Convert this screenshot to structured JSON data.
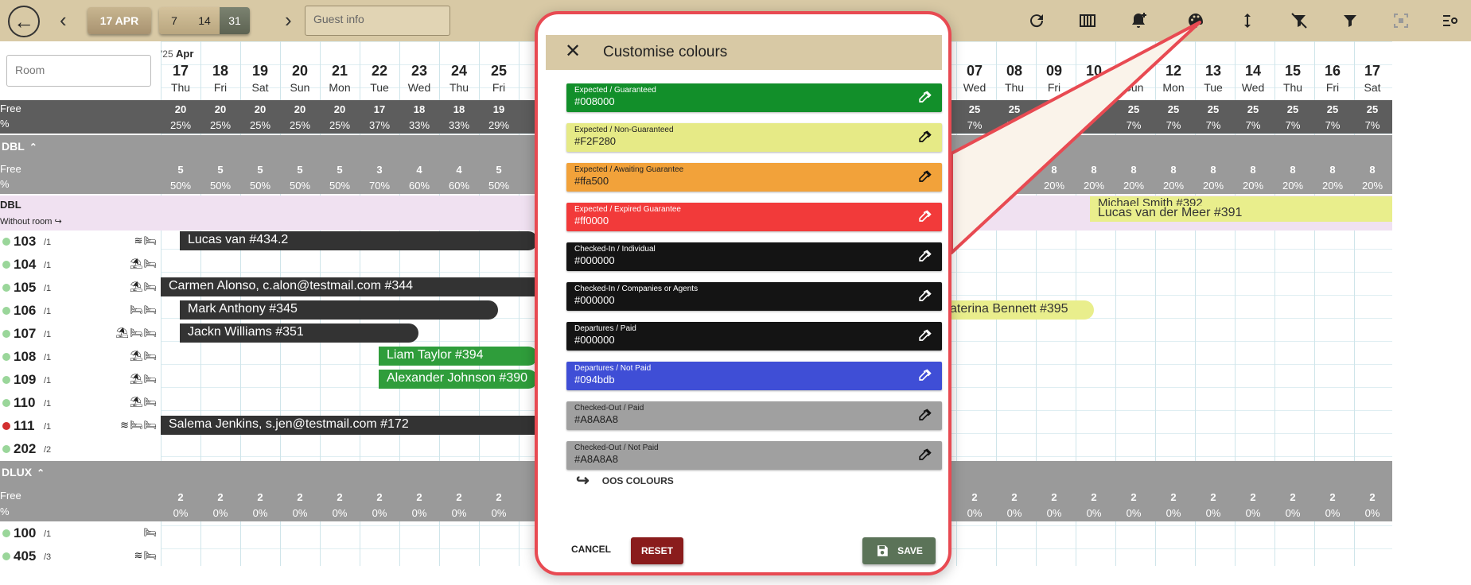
{
  "toolbar": {
    "back_icon": "arrow-left-icon",
    "prev_icon": "chevron-left-icon",
    "date_label": "17 APR",
    "ranges": [
      "7",
      "14",
      "31"
    ],
    "range_selected": "31",
    "next_icon": "chevron-right-icon",
    "guest_placeholder": "Guest info",
    "icons": [
      "refresh-icon",
      "columns-icon",
      "bell-plus-icon",
      "palette-icon",
      "vertical-resize-icon",
      "filter-off-icon",
      "filter-icon",
      "scan-icon",
      "list-settings-icon"
    ]
  },
  "grid": {
    "room_placeholder": "Room",
    "year_prefix": "'25",
    "month": "Apr",
    "dates_left": [
      {
        "d": "17",
        "w": "Thu"
      },
      {
        "d": "18",
        "w": "Fri"
      },
      {
        "d": "19",
        "w": "Sat"
      },
      {
        "d": "20",
        "w": "Sun"
      },
      {
        "d": "21",
        "w": "Mon"
      },
      {
        "d": "22",
        "w": "Tue"
      },
      {
        "d": "23",
        "w": "Wed"
      },
      {
        "d": "24",
        "w": "Thu"
      },
      {
        "d": "25",
        "w": "Fri"
      }
    ],
    "dates_right": [
      {
        "d": "07",
        "w": "Wed"
      },
      {
        "d": "08",
        "w": "Thu"
      },
      {
        "d": "09",
        "w": "Fri"
      },
      {
        "d": "10",
        "w": ""
      },
      {
        "d": "11",
        "w": "Sun"
      },
      {
        "d": "12",
        "w": "Mon"
      },
      {
        "d": "13",
        "w": "Tue"
      },
      {
        "d": "14",
        "w": "Wed"
      },
      {
        "d": "15",
        "w": "Thu"
      },
      {
        "d": "16",
        "w": "Fri"
      },
      {
        "d": "17",
        "w": "Sat"
      }
    ],
    "free_label": "Free",
    "pct_label": "%",
    "total_left": {
      "free": [
        "20",
        "20",
        "20",
        "20",
        "20",
        "17",
        "18",
        "18",
        "19"
      ],
      "pct": [
        "25%",
        "25%",
        "25%",
        "25%",
        "25%",
        "37%",
        "33%",
        "33%",
        "29%"
      ]
    },
    "total_right": {
      "free": [
        "25",
        "25",
        "",
        "",
        "25",
        "25",
        "25",
        "25",
        "25",
        "25",
        "25"
      ],
      "pct": [
        "7%",
        "7%",
        "7%",
        "",
        "7%",
        "7%",
        "7%",
        "7%",
        "7%",
        "7%",
        "7%"
      ]
    },
    "dbl_group": "DBL",
    "dbl_left": {
      "free": [
        "5",
        "5",
        "5",
        "5",
        "5",
        "3",
        "4",
        "4",
        "5"
      ],
      "pct": [
        "50%",
        "50%",
        "50%",
        "50%",
        "50%",
        "70%",
        "60%",
        "60%",
        "50%"
      ]
    },
    "dbl_right": {
      "free": [
        "",
        "",
        "8",
        "8",
        "8",
        "8",
        "8",
        "8",
        "8",
        "8",
        "8"
      ],
      "pct": [
        "",
        "",
        "20%",
        "20%",
        "20%",
        "20%",
        "20%",
        "20%",
        "20%",
        "20%",
        "20%"
      ]
    },
    "dbl_row_title": "DBL",
    "dbl_row_sub": "Without room",
    "rooms": [
      {
        "num": "103",
        "cap": "/1",
        "icons": "≋🛏"
      },
      {
        "num": "104",
        "cap": "/1",
        "icons": "⛱🛏"
      },
      {
        "num": "105",
        "cap": "/1",
        "icons": "⛱🛏"
      },
      {
        "num": "106",
        "cap": "/1",
        "icons": "🛏🛏"
      },
      {
        "num": "107",
        "cap": "/1",
        "icons": "⛱🛏🛏"
      },
      {
        "num": "108",
        "cap": "/1",
        "icons": "⛱🛏"
      },
      {
        "num": "109",
        "cap": "/1",
        "icons": "⛱🛏"
      },
      {
        "num": "110",
        "cap": "/1",
        "icons": "⛱🛏"
      },
      {
        "num": "111",
        "cap": "/1",
        "icons": "≋🛏🛏"
      },
      {
        "num": "202",
        "cap": "/2",
        "icons": ""
      }
    ],
    "bookings": {
      "b1": "Lucas van #434.2",
      "b2": "Carmen Alonso, c.alon@testmail.com #344",
      "b3": "Mark Anthony #345",
      "b4": "Jackn Williams #351",
      "b5": "Liam Taylor #394",
      "b6": "Alexander Johnson #390",
      "b7": "Salema Jenkins, s.jen@testmail.com #172",
      "b8": "Michael Smith #392",
      "b9": "Lucas van der Meer #391",
      "b10": "aterina Bennett #395"
    },
    "dlux_group": "DLUX",
    "dlux_free": "2",
    "dlux_pct": "0%",
    "dlux_rooms": [
      {
        "num": "100",
        "cap": "/1",
        "icons": "🛏"
      },
      {
        "num": "405",
        "cap": "/3",
        "icons": "≋🛏"
      }
    ]
  },
  "modal": {
    "title": "Customise colours",
    "close_icon": "close-icon",
    "swatches": [
      {
        "label": "Expected / Guaranteed",
        "value": "#008000",
        "bg": "#128f2a",
        "fg": "#ffffff"
      },
      {
        "label": "Expected / Non-Guaranteed",
        "value": "#F2F280",
        "bg": "#e6ea86",
        "fg": "#222222"
      },
      {
        "label": "Expected / Awaiting Guarantee",
        "value": "#ffa500",
        "bg": "#f2a23a",
        "fg": "#222222"
      },
      {
        "label": "Expected / Expired Guarantee",
        "value": "#ff0000",
        "bg": "#f23a3a",
        "fg": "#ffffff"
      },
      {
        "label": "Checked-In / Individual",
        "value": "#000000",
        "bg": "#141414",
        "fg": "#ffffff"
      },
      {
        "label": "Checked-In / Companies or Agents",
        "value": "#000000",
        "bg": "#141414",
        "fg": "#ffffff"
      },
      {
        "label": "Departures / Paid",
        "value": "#000000",
        "bg": "#141414",
        "fg": "#ffffff"
      },
      {
        "label": "Departures / Not Paid",
        "value": "#094bdb",
        "bg": "#3f4ed6",
        "fg": "#ffffff"
      },
      {
        "label": "Checked-Out / Paid",
        "value": "#A8A8A8",
        "bg": "#a0a0a0",
        "fg": "#222222"
      },
      {
        "label": "Checked-Out / Not Paid",
        "value": "#A8A8A8",
        "bg": "#a0a0a0",
        "fg": "#222222"
      }
    ],
    "oos_label": "OOS COLOURS",
    "cancel_label": "CANCEL",
    "reset_label": "RESET",
    "save_label": "SAVE"
  },
  "colors": {
    "toolbar_bg": "#d8c9a5",
    "callout_border": "#e84a52",
    "reset_bg": "#8a1c1c",
    "save_bg": "#5b7358"
  }
}
